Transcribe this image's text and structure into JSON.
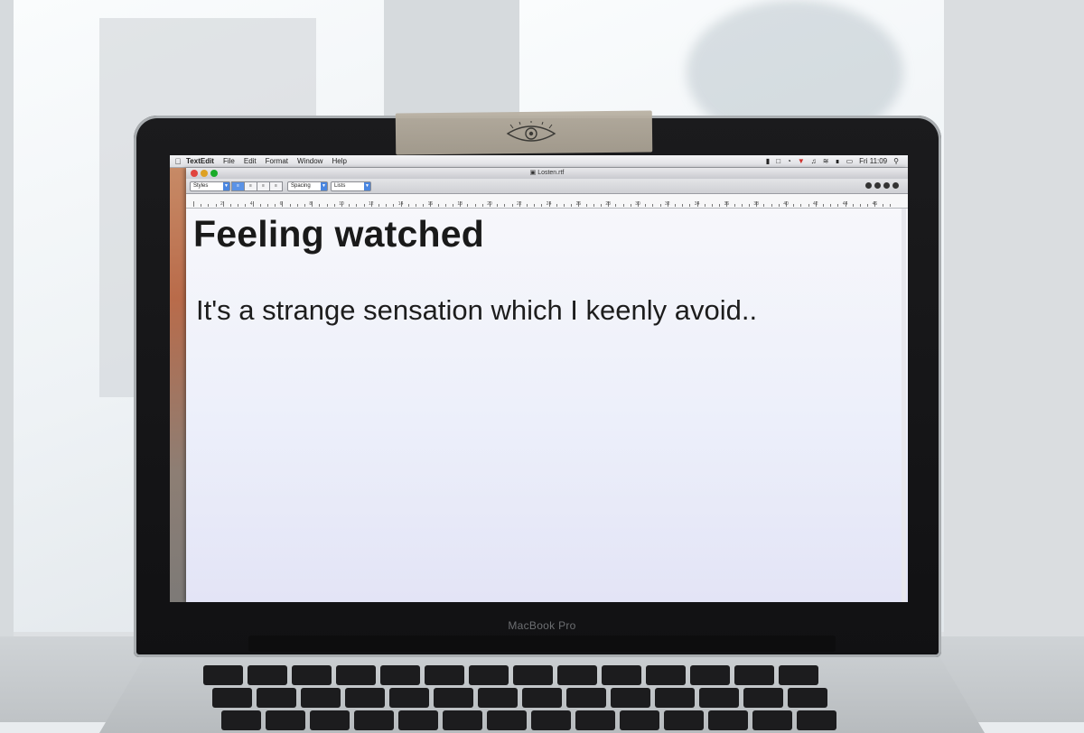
{
  "menubar": {
    "app_name": "TextEdit",
    "items": [
      "File",
      "Edit",
      "Format",
      "Window",
      "Help"
    ],
    "clock": "Fri 11:09"
  },
  "window": {
    "title": "Losten.rtf",
    "toolbar": {
      "styles_label": "Styles",
      "spacing_label": "Spacing",
      "lists_label": "Lists"
    }
  },
  "ruler": {
    "numbers": [
      "2",
      "4",
      "6",
      "8",
      "10",
      "12",
      "14",
      "16",
      "18",
      "20",
      "22",
      "24",
      "26",
      "28",
      "30",
      "32",
      "34",
      "36",
      "38",
      "40",
      "42",
      "44",
      "46"
    ]
  },
  "document": {
    "heading": "Feeling watched",
    "body": "It's a strange sensation which I keenly avoid.."
  },
  "laptop": {
    "brand_label": "MacBook Pro"
  },
  "colors": {
    "accent": "#4a86e0",
    "tape": "#b3ab9d"
  }
}
